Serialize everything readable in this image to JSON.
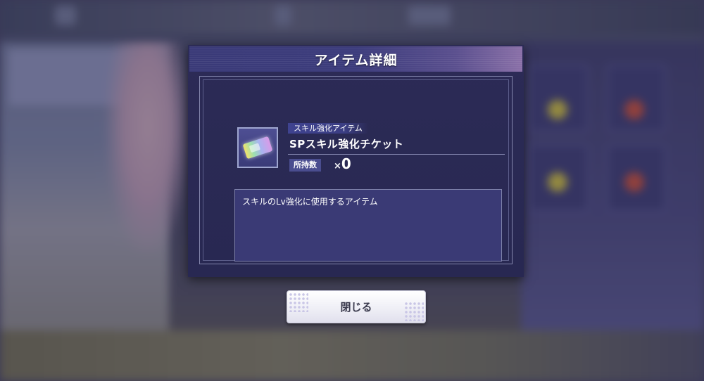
{
  "dialog": {
    "title": "アイテム詳細"
  },
  "item": {
    "category": "スキル強化アイテム",
    "name": "SPスキル強化チケット",
    "icon": "ticket-icon",
    "owned_label": "所持数",
    "owned_prefix": "×",
    "owned_count": "0",
    "description": "スキルのLv強化に使用するアイテム"
  },
  "buttons": {
    "close_label": "閉じる"
  },
  "colors": {
    "dialog_bg": "#2c2b56",
    "header_accent": "#8a70a8",
    "panel_border": "#8486ad",
    "button_bg": "#ffffff",
    "button_text": "#3b3b4e"
  }
}
